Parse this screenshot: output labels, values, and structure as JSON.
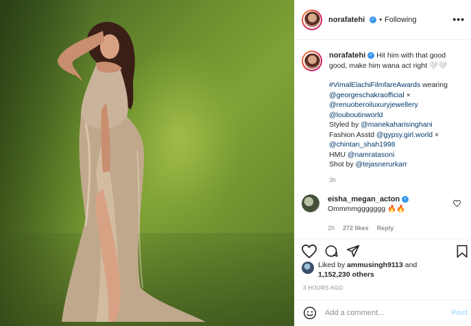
{
  "header": {
    "username": "norafatehi",
    "separator": "•",
    "follow_status": "Following",
    "more": "•••"
  },
  "caption": {
    "username": "norafatehi",
    "text": "Hit him with that good good, make him wana act right 🤍🤍",
    "hashtag": "#VimalElachiFilmfareAwards",
    "wearing": " wearing",
    "mention1": "@georgeschakraofficial",
    "x1": " ×",
    "mention2": "@renuoberoiluxuryjewellery",
    "mention3": "@louboutinworld",
    "styled_prefix": "Styled by ",
    "styled_mention": "@manekaharisinghani",
    "fashion_prefix": "Fashion Asstd ",
    "fashion_mention": "@gypsy.girl.world",
    "x2": " ×",
    "mention4": "@chintan_shah1998",
    "hmu_prefix": "HMU ",
    "hmu_mention": "@namratasoni",
    "shot_prefix": "Shot by ",
    "shot_mention": "@tejasnerurkarr",
    "time": "3h"
  },
  "comment": {
    "username": "eisha_megan_acton",
    "text": "Ommmmggggggg 🔥🔥",
    "time": "2h",
    "likes": "272 likes",
    "reply": "Reply"
  },
  "likes": {
    "prefix": "Liked by ",
    "user": "ammusingh9113",
    "and": " and",
    "count": "1,152,230 others"
  },
  "date": "3 HOURS AGO",
  "add_comment": {
    "placeholder": "Add a comment...",
    "post": "Post"
  },
  "colors": {
    "link": "#00376b",
    "verified": "#3897f0",
    "muted": "#8e8e8e"
  },
  "icons": [
    "heart-icon",
    "comment-icon",
    "share-icon",
    "bookmark-icon",
    "smile-icon",
    "verified-icon"
  ]
}
